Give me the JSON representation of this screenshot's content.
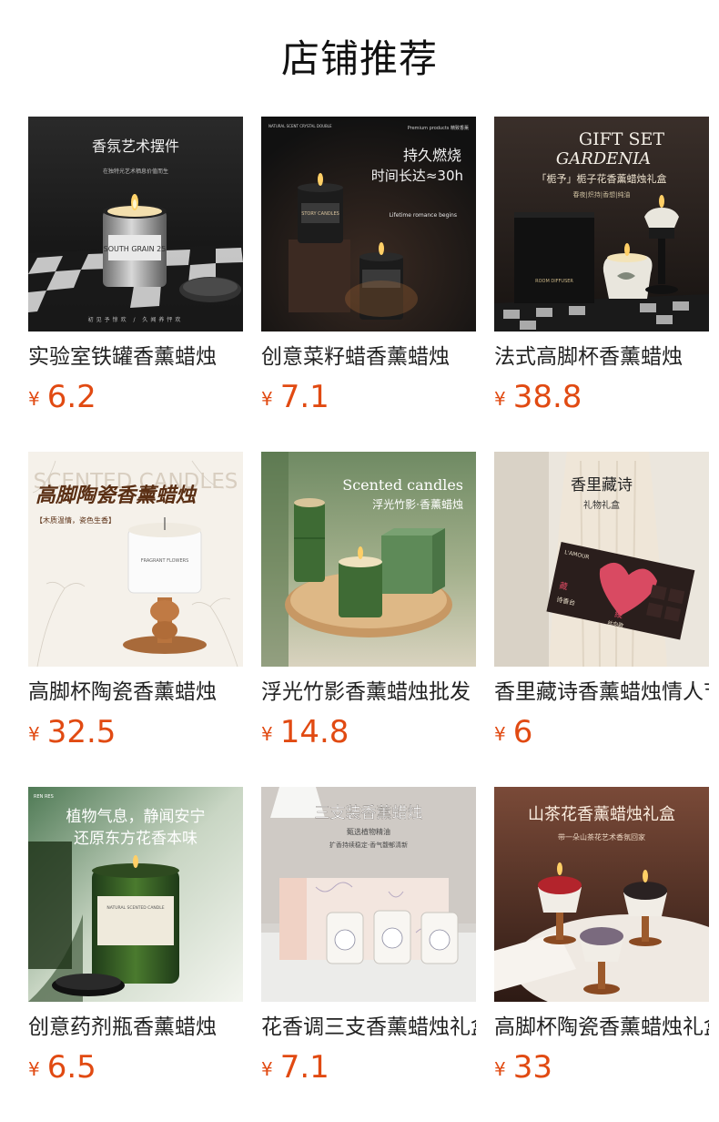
{
  "page": {
    "title": "店铺推荐"
  },
  "currency_symbol": "¥",
  "products": [
    {
      "name": "实验室铁罐香薰蜡烛",
      "price": "6.2",
      "image": {
        "headline": "香氛艺术摆件",
        "subline": "在独特光艺术栖息价值而生",
        "bottom": "初见予惊欢 / 久闻养怦欢",
        "label": "SOUTH GRAIN 25"
      }
    },
    {
      "name": "创意菜籽蜡香薰蜡烛",
      "price": "7.1",
      "image": {
        "top_left": "NATURAL SCENT CRYSTAL DOUBLE",
        "top_right": "Premium products 精致香薰",
        "headline1": "持久燃烧",
        "headline2": "时间长达≈30h",
        "tagline": "Lifetime romance begins",
        "label": "STORY CANDLES"
      }
    },
    {
      "name": "法式高脚杯香薰蜡烛",
      "price": "38.8",
      "image": {
        "line1": "GIFT SET",
        "line2": "GARDENIA",
        "line3": "「栀予」栀子花香薰蜡烛礼盒",
        "line4": "春夜|炽持|香想|纯油",
        "box_label": "ROOM DIFFUSER"
      }
    },
    {
      "name": "高脚杯陶瓷香薰蜡烛",
      "price": "32.5",
      "image": {
        "watermark": "SCENTED CANDLES",
        "headline": "高脚陶瓷香薰蜡烛",
        "tag": "【木质温情，瓷色生香】",
        "label": "FRAGRANT FLOWERS"
      }
    },
    {
      "name": "浮光竹影香薰蜡烛批发",
      "price": "14.8",
      "image": {
        "line1": "Scented candles",
        "line2": "浮光竹影·香薰蜡烛"
      }
    },
    {
      "name": "香里藏诗香薰蜡烛情人节",
      "price": "6",
      "image": {
        "line1": "香里藏诗",
        "line2": "礼物礼盒",
        "box_brand": "L'AMOUR",
        "box_text1": "藏",
        "box_text2": "诗香台",
        "box_text3": "縱",
        "box_text4": "丝向歌"
      }
    },
    {
      "name": "创意药剂瓶香薰蜡烛",
      "price": "6.5",
      "image": {
        "corner": "REN RES",
        "line1": "植物气息，静闻安宁",
        "line2": "还原东方花香本味",
        "label": "NATURAL SCENTED CANDLE"
      }
    },
    {
      "name": "花香调三支香薰蜡烛礼盒",
      "price": "7.1",
      "image": {
        "line1": "三支装香薰蜡烛",
        "line2": "甄选植物精油",
        "line3": "扩香持续稳定·香气馥郁清新"
      }
    },
    {
      "name": "高脚杯陶瓷香薰蜡烛礼盒",
      "price": "33",
      "image": {
        "line1": "山茶花香薰蜡烛礼盒",
        "line2": "带一朵山茶花艺术香氛回家"
      }
    }
  ]
}
